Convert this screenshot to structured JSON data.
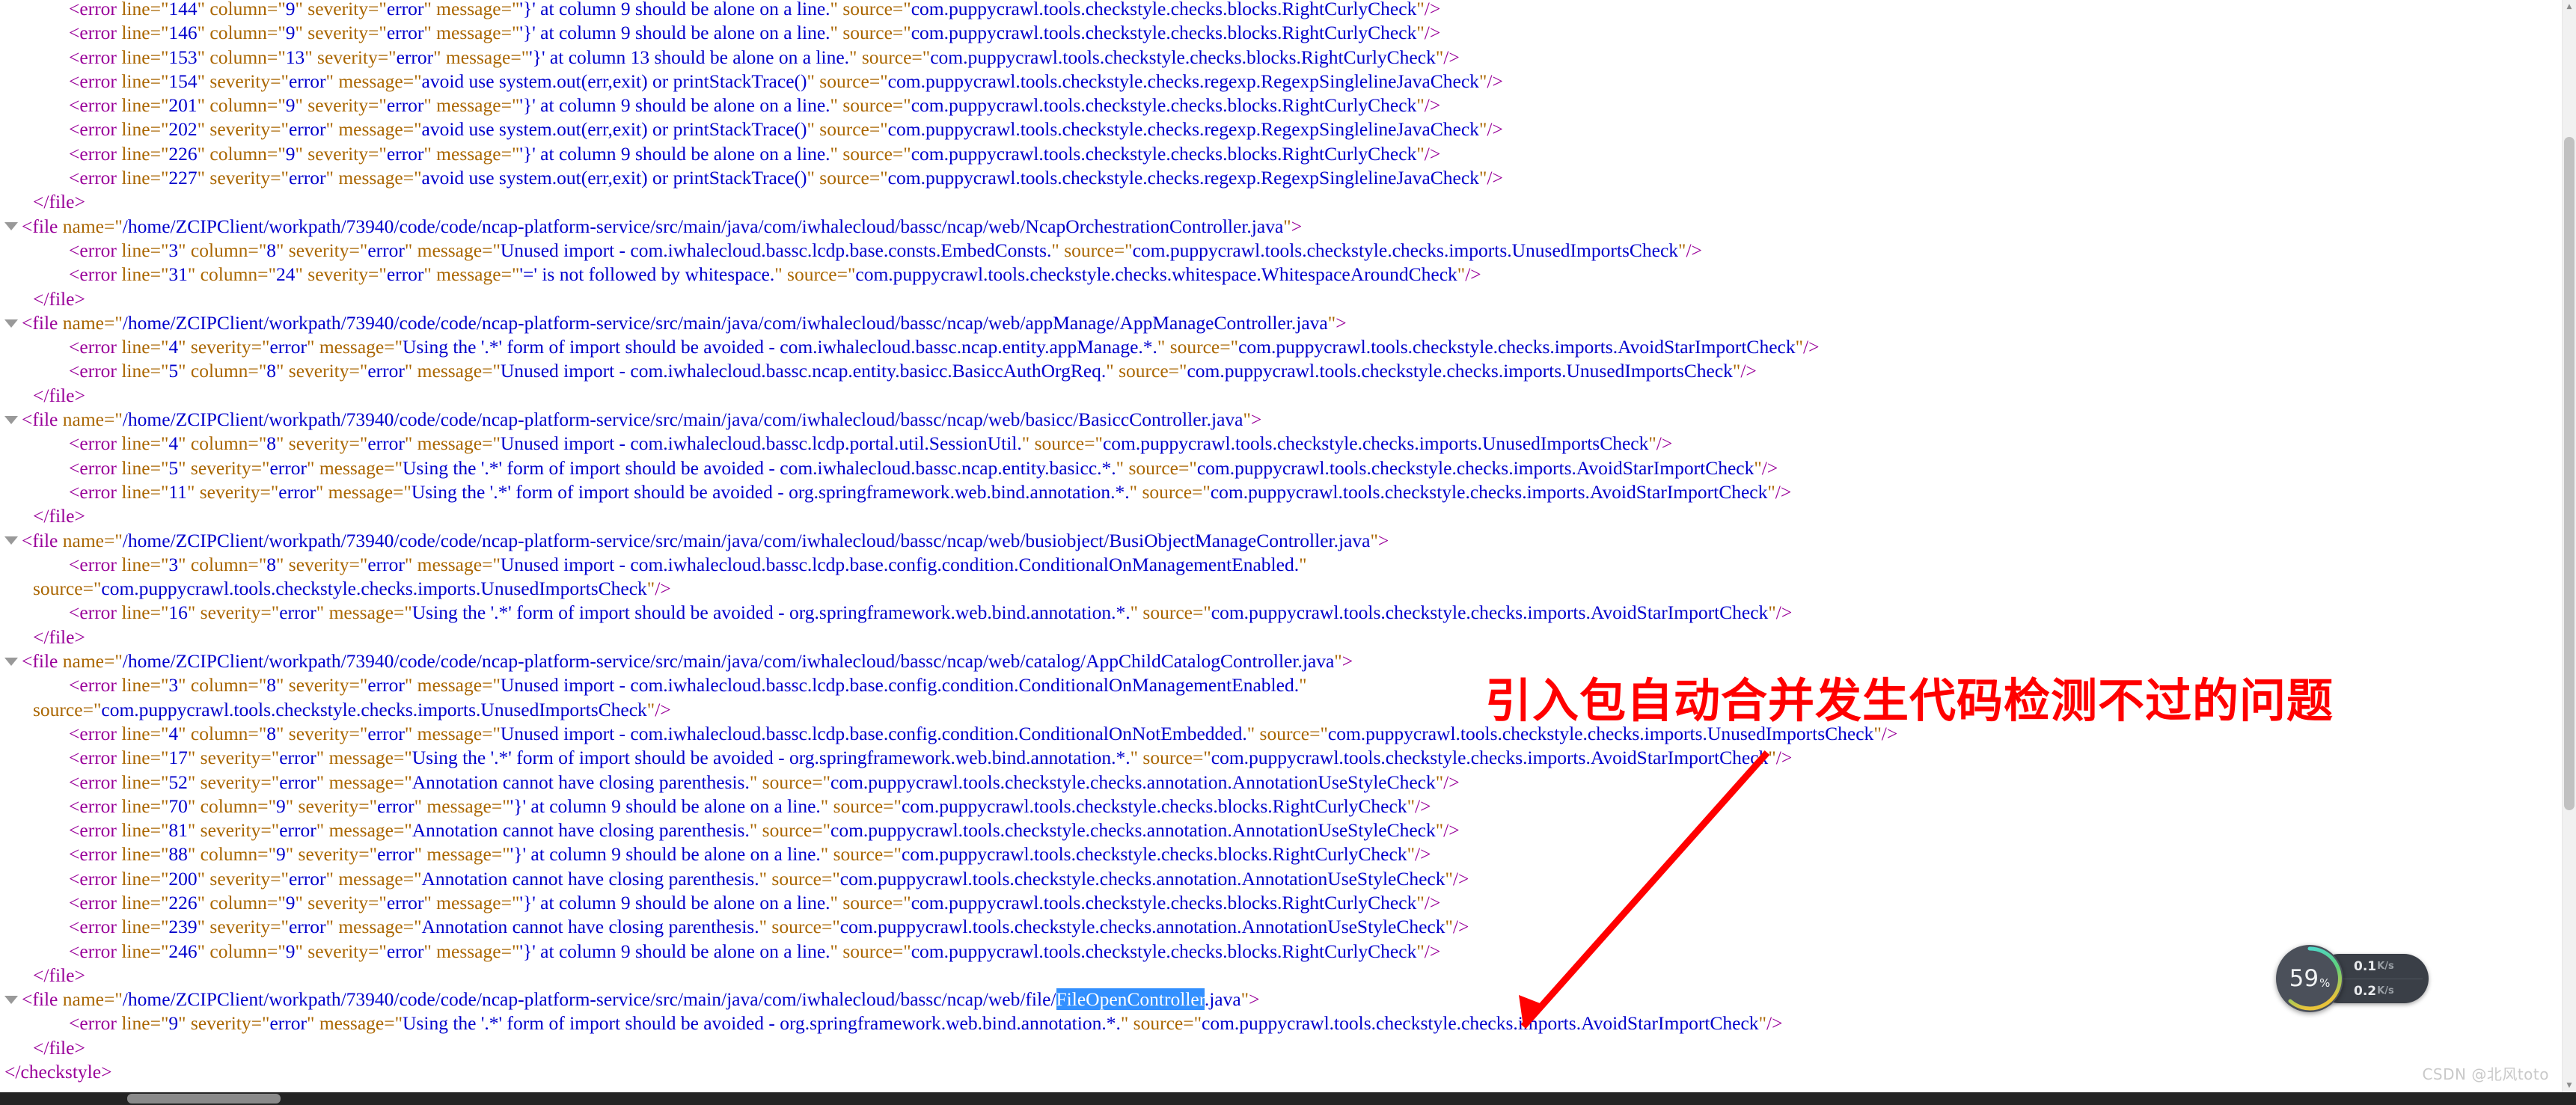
{
  "document": {
    "root_close": "</checkstyle>",
    "file_close": "</file>",
    "blocks": [
      {
        "type": "errors-tail",
        "errors": [
          {
            "line": "144",
            "column": "9",
            "severity": "error",
            "message": "'}' at column 9 should be alone on a line.",
            "source": "com.puppycrawl.tools.checkstyle.checks.blocks.RightCurlyCheck"
          },
          {
            "line": "146",
            "column": "9",
            "severity": "error",
            "message": "'}' at column 9 should be alone on a line.",
            "source": "com.puppycrawl.tools.checkstyle.checks.blocks.RightCurlyCheck"
          },
          {
            "line": "153",
            "column": "13",
            "severity": "error",
            "message": "'}' at column 13 should be alone on a line.",
            "source": "com.puppycrawl.tools.checkstyle.checks.blocks.RightCurlyCheck"
          },
          {
            "line": "154",
            "column": "",
            "severity": "error",
            "message": "avoid use system.out(err,exit) or printStackTrace()",
            "source": "com.puppycrawl.tools.checkstyle.checks.regexp.RegexpSinglelineJavaCheck"
          },
          {
            "line": "201",
            "column": "9",
            "severity": "error",
            "message": "'}' at column 9 should be alone on a line.",
            "source": "com.puppycrawl.tools.checkstyle.checks.blocks.RightCurlyCheck"
          },
          {
            "line": "202",
            "column": "",
            "severity": "error",
            "message": "avoid use system.out(err,exit) or printStackTrace()",
            "source": "com.puppycrawl.tools.checkstyle.checks.regexp.RegexpSinglelineJavaCheck"
          },
          {
            "line": "226",
            "column": "9",
            "severity": "error",
            "message": "'}' at column 9 should be alone on a line.",
            "source": "com.puppycrawl.tools.checkstyle.checks.blocks.RightCurlyCheck"
          },
          {
            "line": "227",
            "column": "",
            "severity": "error",
            "message": "avoid use system.out(err,exit) or printStackTrace()",
            "source": "com.puppycrawl.tools.checkstyle.checks.regexp.RegexpSinglelineJavaCheck"
          }
        ]
      },
      {
        "type": "file",
        "name": "/home/ZCIPClient/workpath/73940/code/code/ncap-platform-service/src/main/java/com/iwhalecloud/bassc/ncap/web/NcapOrchestrationController.java",
        "errors": [
          {
            "line": "3",
            "column": "8",
            "severity": "error",
            "message": "Unused import - com.iwhalecloud.bassc.lcdp.base.consts.EmbedConsts.",
            "source": "com.puppycrawl.tools.checkstyle.checks.imports.UnusedImportsCheck"
          },
          {
            "line": "31",
            "column": "24",
            "severity": "error",
            "message": "'=' is not followed by whitespace.",
            "source": "com.puppycrawl.tools.checkstyle.checks.whitespace.WhitespaceAroundCheck"
          }
        ]
      },
      {
        "type": "file",
        "name": "/home/ZCIPClient/workpath/73940/code/code/ncap-platform-service/src/main/java/com/iwhalecloud/bassc/ncap/web/appManage/AppManageController.java",
        "errors": [
          {
            "line": "4",
            "column": "",
            "severity": "error",
            "message": "Using the '.*' form of import should be avoided - com.iwhalecloud.bassc.ncap.entity.appManage.*.",
            "source": "com.puppycrawl.tools.checkstyle.checks.imports.AvoidStarImportCheck"
          },
          {
            "line": "5",
            "column": "8",
            "severity": "error",
            "message": "Unused import - com.iwhalecloud.bassc.ncap.entity.basicc.BasiccAuthOrgReq.",
            "source": "com.puppycrawl.tools.checkstyle.checks.imports.UnusedImportsCheck"
          }
        ]
      },
      {
        "type": "file",
        "name": "/home/ZCIPClient/workpath/73940/code/code/ncap-platform-service/src/main/java/com/iwhalecloud/bassc/ncap/web/basicc/BasiccController.java",
        "errors": [
          {
            "line": "4",
            "column": "8",
            "severity": "error",
            "message": "Unused import - com.iwhalecloud.bassc.lcdp.portal.util.SessionUtil.",
            "source": "com.puppycrawl.tools.checkstyle.checks.imports.UnusedImportsCheck"
          },
          {
            "line": "5",
            "column": "",
            "severity": "error",
            "message": "Using the '.*' form of import should be avoided - com.iwhalecloud.bassc.ncap.entity.basicc.*.",
            "source": "com.puppycrawl.tools.checkstyle.checks.imports.AvoidStarImportCheck"
          },
          {
            "line": "11",
            "column": "",
            "severity": "error",
            "message": "Using the '.*' form of import should be avoided - org.springframework.web.bind.annotation.*.",
            "source": "com.puppycrawl.tools.checkstyle.checks.imports.AvoidStarImportCheck"
          }
        ]
      },
      {
        "type": "file",
        "name": "/home/ZCIPClient/workpath/73940/code/code/ncap-platform-service/src/main/java/com/iwhalecloud/bassc/ncap/web/busiobject/BusiObjectManageController.java",
        "errors": [
          {
            "line": "3",
            "column": "8",
            "severity": "error",
            "message": "Unused import - com.iwhalecloud.bassc.lcdp.base.config.condition.ConditionalOnManagementEnabled.",
            "source": "com.puppycrawl.tools.checkstyle.checks.imports.UnusedImportsCheck",
            "wrap": true
          },
          {
            "line": "16",
            "column": "",
            "severity": "error",
            "message": "Using the '.*' form of import should be avoided - org.springframework.web.bind.annotation.*.",
            "source": "com.puppycrawl.tools.checkstyle.checks.imports.AvoidStarImportCheck"
          }
        ]
      },
      {
        "type": "file",
        "name": "/home/ZCIPClient/workpath/73940/code/code/ncap-platform-service/src/main/java/com/iwhalecloud/bassc/ncap/web/catalog/AppChildCatalogController.java",
        "errors": [
          {
            "line": "3",
            "column": "8",
            "severity": "error",
            "message": "Unused import - com.iwhalecloud.bassc.lcdp.base.config.condition.ConditionalOnManagementEnabled.",
            "source": "com.puppycrawl.tools.checkstyle.checks.imports.UnusedImportsCheck",
            "wrap": true
          },
          {
            "line": "4",
            "column": "8",
            "severity": "error",
            "message": "Unused import - com.iwhalecloud.bassc.lcdp.base.config.condition.ConditionalOnNotEmbedded.",
            "source": "com.puppycrawl.tools.checkstyle.checks.imports.UnusedImportsCheck"
          },
          {
            "line": "17",
            "column": "",
            "severity": "error",
            "message": "Using the '.*' form of import should be avoided - org.springframework.web.bind.annotation.*.",
            "source": "com.puppycrawl.tools.checkstyle.checks.imports.AvoidStarImportCheck"
          },
          {
            "line": "52",
            "column": "",
            "severity": "error",
            "message": "Annotation cannot have closing parenthesis.",
            "source": "com.puppycrawl.tools.checkstyle.checks.annotation.AnnotationUseStyleCheck"
          },
          {
            "line": "70",
            "column": "9",
            "severity": "error",
            "message": "'}' at column 9 should be alone on a line.",
            "source": "com.puppycrawl.tools.checkstyle.checks.blocks.RightCurlyCheck"
          },
          {
            "line": "81",
            "column": "",
            "severity": "error",
            "message": "Annotation cannot have closing parenthesis.",
            "source": "com.puppycrawl.tools.checkstyle.checks.annotation.AnnotationUseStyleCheck"
          },
          {
            "line": "88",
            "column": "9",
            "severity": "error",
            "message": "'}' at column 9 should be alone on a line.",
            "source": "com.puppycrawl.tools.checkstyle.checks.blocks.RightCurlyCheck"
          },
          {
            "line": "200",
            "column": "",
            "severity": "error",
            "message": "Annotation cannot have closing parenthesis.",
            "source": "com.puppycrawl.tools.checkstyle.checks.annotation.AnnotationUseStyleCheck"
          },
          {
            "line": "226",
            "column": "9",
            "severity": "error",
            "message": "'}' at column 9 should be alone on a line.",
            "source": "com.puppycrawl.tools.checkstyle.checks.blocks.RightCurlyCheck"
          },
          {
            "line": "239",
            "column": "",
            "severity": "error",
            "message": "Annotation cannot have closing parenthesis.",
            "source": "com.puppycrawl.tools.checkstyle.checks.annotation.AnnotationUseStyleCheck"
          },
          {
            "line": "246",
            "column": "9",
            "severity": "error",
            "message": "'}' at column 9 should be alone on a line.",
            "source": "com.puppycrawl.tools.checkstyle.checks.blocks.RightCurlyCheck"
          }
        ]
      },
      {
        "type": "file",
        "name_prefix": "/home/ZCIPClient/workpath/73940/code/code/ncap-platform-service/src/main/java/com/iwhalecloud/bassc/ncap/web/file/",
        "name_selected": "FileOpenController",
        "name_suffix": ".java",
        "errors": [
          {
            "line": "9",
            "column": "",
            "severity": "error",
            "message": "Using the '.*' form of import should be avoided - org.springframework.web.bind.annotation.*.",
            "source": "com.puppycrawl.tools.checkstyle.checks.imports.AvoidStarImportCheck"
          }
        ]
      }
    ]
  },
  "annotation": {
    "text": "引入包自动合并发生代码检测不过的问题",
    "color": "#ff0000"
  },
  "system_monitor": {
    "cpu_percent": "59",
    "percent_sign": "%",
    "upload_value": "0.1",
    "upload_unit": "K/s",
    "download_value": "0.2",
    "download_unit": "K/s",
    "upload_arrow": "▲",
    "download_arrow": "▼",
    "gauge_color_start": "#4ad9d9",
    "gauge_color_end": "#e8c33a"
  },
  "watermark": {
    "text": "CSDN @北风toto"
  },
  "scrollbar": {
    "up_arrow": "▲",
    "down_arrow": "▼"
  }
}
